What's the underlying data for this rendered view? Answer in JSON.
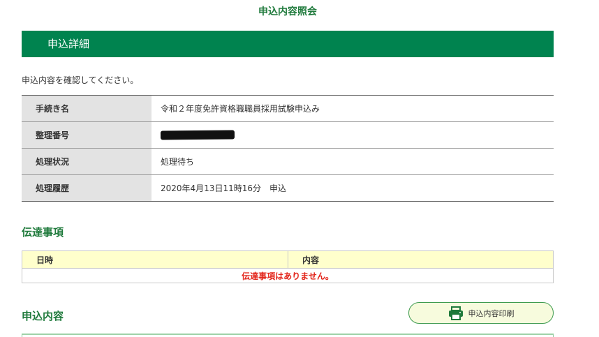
{
  "page": {
    "title": "申込内容照会"
  },
  "detail": {
    "banner_title": "申込詳細",
    "instruction": "申込内容を確認してください。",
    "rows": [
      {
        "label": "手続き名",
        "value": "令和２年度免許資格職職員採用試験申込み"
      },
      {
        "label": "整理番号",
        "value": null,
        "redacted": true
      },
      {
        "label": "処理状況",
        "value": "処理待ち"
      },
      {
        "label": "処理履歴",
        "value": "2020年4月13日11時16分　申込"
      }
    ]
  },
  "messages": {
    "heading": "伝達事項",
    "columns": [
      "日時",
      "内容"
    ],
    "empty_text": "伝達事項はありません。"
  },
  "application": {
    "heading": "申込内容",
    "print_button": {
      "label": "申込内容印刷",
      "icon": "printer-icon"
    }
  },
  "colors": {
    "brand_green": "#00834f",
    "heading_green": "#1f7a3c",
    "label_bg": "#e3e3e3",
    "table_header_bg": "#ffffcc",
    "alert_red": "#e3261b",
    "button_bg": "#f7fbdd"
  }
}
